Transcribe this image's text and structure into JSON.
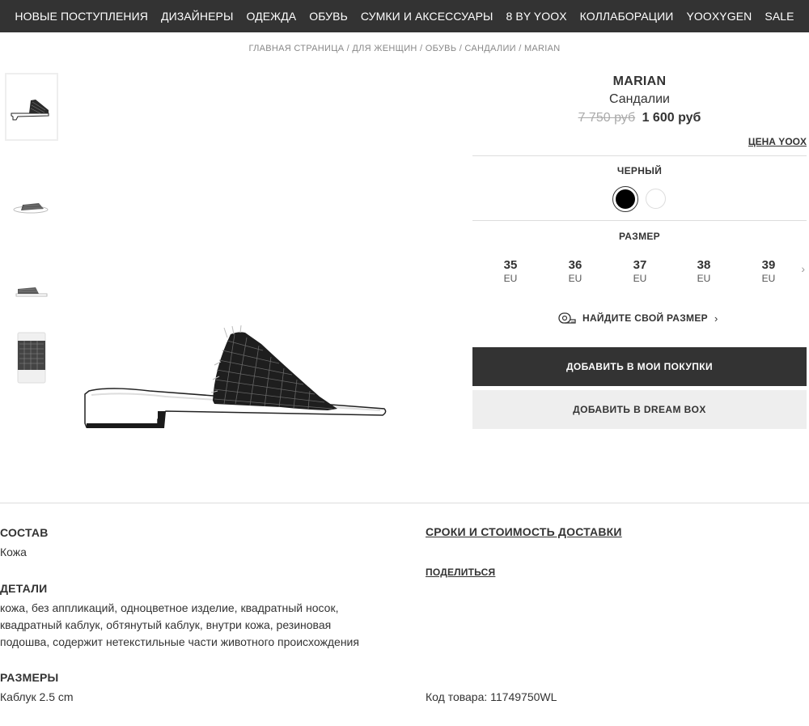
{
  "nav": {
    "items": [
      "НОВЫЕ ПОСТУПЛЕНИЯ",
      "ДИЗАЙНЕРЫ",
      "ОДЕЖДА",
      "ОБУВЬ",
      "СУМКИ И АКСЕССУАРЫ",
      "8 BY YOOX",
      "КОЛЛАБОРАЦИИ",
      "YOOXYGEN",
      "SALE"
    ]
  },
  "breadcrumb": [
    "ГЛАВНАЯ СТРАНИЦА",
    "ДЛЯ ЖЕНЩИН",
    "ОБУВЬ",
    "САНДАЛИИ",
    "MARIAN"
  ],
  "breadcrumb_sep": " / ",
  "product": {
    "brand": "MARIAN",
    "category": "Сандалии",
    "old_price": "7 750 руб",
    "new_price": "1 600 руб",
    "price_link": "ЦЕНА YOOX",
    "color_label": "ЧЕРНЫЙ",
    "colors": [
      "#000000",
      "#ffffff"
    ],
    "size_label": "РАЗМЕР",
    "sizes": [
      {
        "num": "35",
        "unit": "EU"
      },
      {
        "num": "36",
        "unit": "EU"
      },
      {
        "num": "37",
        "unit": "EU"
      },
      {
        "num": "38",
        "unit": "EU"
      },
      {
        "num": "39",
        "unit": "EU"
      }
    ],
    "find_size": "НАЙДИТЕ СВОЙ РАЗМЕР",
    "add_to_cart": "ДОБАВИТЬ В МОИ ПОКУПКИ",
    "add_to_dreambox": "ДОБАВИТЬ В DREAM BOX"
  },
  "info": {
    "composition_title": "СОСТАВ",
    "composition": "Кожа",
    "details_title": "ДЕТАЛИ",
    "details_lines": [
      "кожа, без аппликаций, одноцветное изделие, квадратный носок,",
      "квадратный каблук, обтянутый каблук, внутри кожа, резиновая",
      "подошва, содержит нетекстильные части животного происхождения"
    ],
    "sizes_title": "РАЗМЕРЫ",
    "sizes_text": "Каблук 2.5 cm",
    "delivery_link": "СРОКИ И СТОИМОСТЬ ДОСТАВКИ",
    "share_link": "ПОДЕЛИТЬСЯ",
    "sku": "Код товара: 11749750WL"
  }
}
